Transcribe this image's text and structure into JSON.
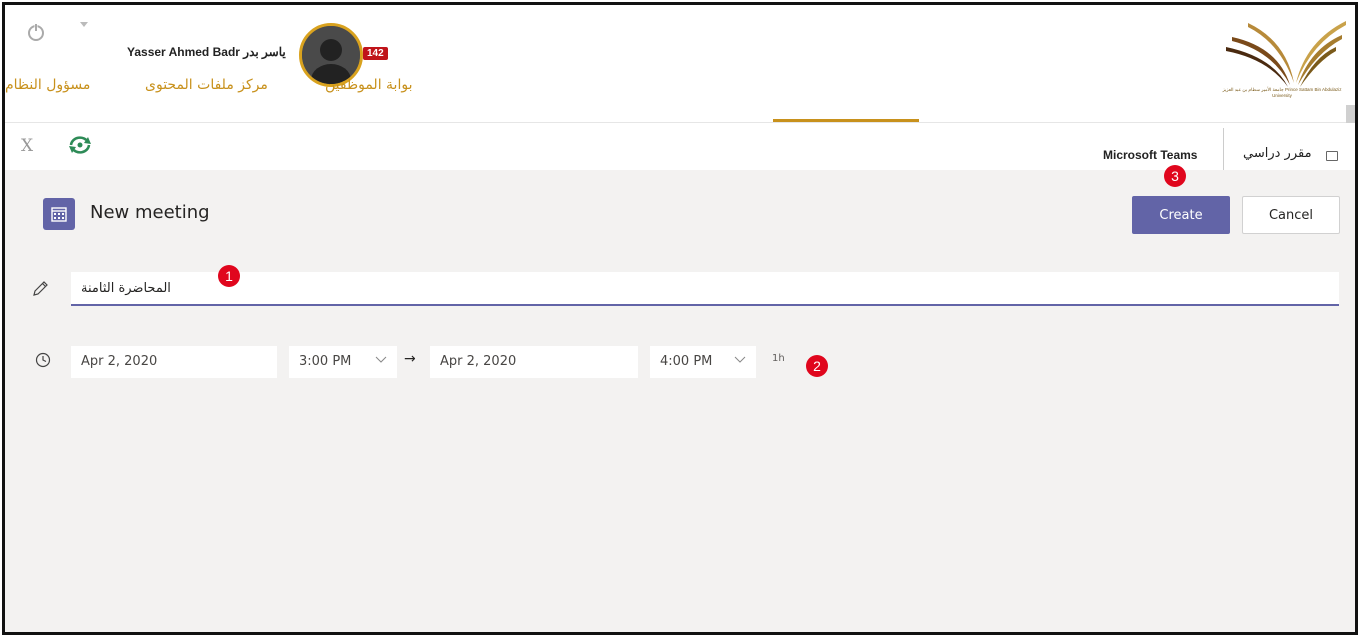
{
  "header": {
    "user_name": "Yasser Ahmed Badr ياسر بدر",
    "notification_count": "142",
    "nav": [
      {
        "label": "بوابة الموظفين",
        "active": true
      },
      {
        "label": "مركز ملفات المحتوى",
        "active": false
      },
      {
        "label": "مسؤول النظام",
        "active": false
      }
    ],
    "logo_text": "جامعة الأمير سطام بن عبد العزيز Prince Sattam Bin Abdulaziz University"
  },
  "tabbar": {
    "close_label": "X",
    "teams_label": "Microsoft Teams",
    "course_tab": "مقرر دراسي"
  },
  "meeting": {
    "title": "New meeting",
    "create_label": "Create",
    "cancel_label": "Cancel",
    "title_value": "المحاضرة الثامنة",
    "start_date": "Apr 2, 2020",
    "start_time": "3:00 PM",
    "end_date": "Apr 2, 2020",
    "end_time": "4:00 PM",
    "duration": "1h",
    "arrow": "→"
  },
  "steps": [
    "1",
    "2",
    "3"
  ],
  "colors": {
    "accent": "#6264a7",
    "gold": "#c8911c",
    "badge": "#c0141a",
    "step_marker": "#e0061d"
  }
}
